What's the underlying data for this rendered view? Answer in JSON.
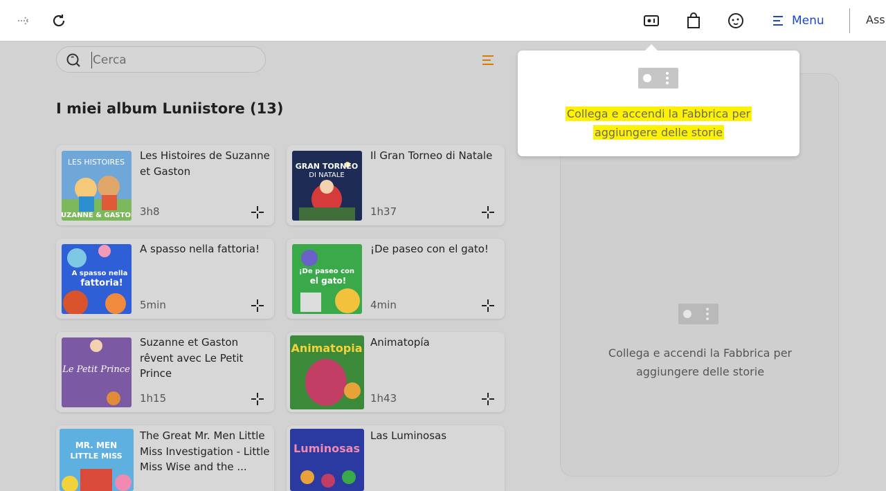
{
  "header": {
    "menu_label": "Menu",
    "assistance_label": "Ass",
    "accent_color": "#1b45d6"
  },
  "search": {
    "placeholder": "Cerca",
    "value": ""
  },
  "library": {
    "title": "I miei album Luniistore (13)",
    "albums": [
      {
        "title": "Les Histoires de Suzanne et Gaston",
        "duration": "3h8",
        "cover_text": "LES HISTOIRES DE SUZANNE & GASTON"
      },
      {
        "title": "Il Gran Torneo di Natale",
        "duration": "1h37",
        "cover_text": "IL GRAN TORNEO DI NATALE"
      },
      {
        "title": "A spasso nella fattoria!",
        "duration": "5min",
        "cover_text": "A spasso nella fattoria!"
      },
      {
        "title": "¡De paseo con el gato!",
        "duration": "4min",
        "cover_text": "¡De paseo con el gato!"
      },
      {
        "title": "Suzanne et Gaston rêvent avec Le Petit Prince",
        "duration": "1h15",
        "cover_text": "Le Petit Prince"
      },
      {
        "title": "Animatopía",
        "duration": "1h43",
        "cover_text": "Animatopia"
      },
      {
        "title": "The Great Mr. Men Little Miss Investigation - Little Miss Wise and the ...",
        "duration": "",
        "cover_text": "MR. MEN LITTLE MISS"
      },
      {
        "title": "Las Luminosas",
        "duration": "",
        "cover_text": "Las Luminosas"
      }
    ]
  },
  "factory_panel": {
    "message": "Collega e accendi la Fabbrica per aggiungere delle storie"
  },
  "popover": {
    "message": "Collega e accendi la Fabbrica per aggiungere delle storie",
    "highlight_color": "#fff200"
  }
}
